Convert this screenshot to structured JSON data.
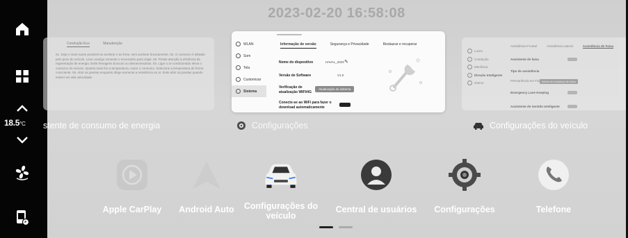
{
  "left_bar": {
    "temperature": "18.5",
    "temperature_unit": "°C"
  },
  "header": {
    "datetime": "2023-02-20 16:58:08"
  },
  "cards": {
    "left": {
      "tabs": [
        "Condução Eco",
        "Manutenção"
      ],
      "text": "01. Seja o mais suave possível ao acelerar e ao frear, sem acelerar bruscamente. 02. O consumo é afetado pelo peso do veículo. Leve consigo somente o necessário para viajar. 03. Preste atenção à eficiência da regeneração de energia. Evite frenagens bruscas ou desnecessárias. 04. Ligar o ar-condicionado eleva o consumo do veículo. Quanto mais frio a temperatura, maior o consumo. Selecione a temperatura de forma consciente. 05. Abrir as janelas enquanto dirige aumenta a resistência ao ar. Evite abrir as janelas quando estiver em alta velocidade."
    },
    "center": {
      "sidebar": [
        "WLAN",
        "Som",
        "Tela",
        "Customizar",
        "Sistema"
      ],
      "tabs": [
        "Informação de versão",
        "Segurança e Privacidade",
        "Restaurar e recuperar"
      ],
      "device_name_label": "Nome do dispositivo",
      "device_name_value": "HAVAL_2023",
      "software_label": "Versão de Software",
      "software_value": "V1.0",
      "update_label": "Verificação de atualização WIFI/4G",
      "update_button": "Atualização do sistema",
      "wifi_label": "Conecte-se ao WiFi para fazer o download automaticamente"
    },
    "right": {
      "sidebar": [
        "Luzes",
        "Condução",
        "Mecânica",
        "Direção Inteligente",
        "Outros"
      ],
      "tabs": [
        "Assistência Frontal",
        "Assistência Lateral",
        "Assistência de Faixa"
      ],
      "rows": [
        "Assistente de faixa",
        "Tipo de assistência",
        "Emergency Lane Keeping",
        "Assistente de Sentido Inteligente"
      ],
      "option_a": "Permanência em Faixa",
      "option_b": "Alerta de mudança de faixa"
    }
  },
  "captions": {
    "left": "stente de consumo de energia",
    "center": "Configurações",
    "right": "Configurações do veículo"
  },
  "dock": [
    {
      "label": "Apple CarPlay",
      "icon": "carplay-icon"
    },
    {
      "label": "Android Auto",
      "icon": "android-auto-icon"
    },
    {
      "label": "Configurações do veículo",
      "icon": "car-icon"
    },
    {
      "label": "Central de usuários",
      "icon": "user-icon"
    },
    {
      "label": "Configurações",
      "icon": "gear-icon"
    },
    {
      "label": "Telefone",
      "icon": "phone-icon"
    }
  ],
  "pagination": {
    "current": 1,
    "total": 2
  }
}
